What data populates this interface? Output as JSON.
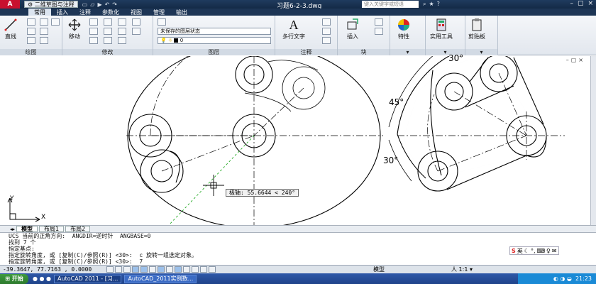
{
  "titlebar": {
    "app_logo": "A",
    "workspace": "二维草图与注释",
    "title": "习题6-2-3.dwg",
    "search_placeholder": "键入关键字或短语",
    "qat": [
      "▭",
      "▱",
      "▶",
      "↶",
      "↷"
    ],
    "title_icons": [
      "⌕",
      "★",
      "?"
    ],
    "window_buttons": [
      "–",
      "▢",
      "×"
    ]
  },
  "ribbon_tabs": [
    "常用",
    "插入",
    "注释",
    "参数化",
    "视图",
    "管理",
    "输出"
  ],
  "ribbon": {
    "panels": {
      "draw": "绘图",
      "modify": "修改",
      "layer": "图层",
      "annotation": "注释",
      "block": "块"
    },
    "draw_line": "直线",
    "modify_move": "移动",
    "layer_state": "未保存的图层状态",
    "layer_name": "0",
    "mtext": "多行文字",
    "insert": "插入",
    "properties": "特性",
    "utilities": "实用工具",
    "clipboard": "剪贴板"
  },
  "drawing": {
    "dim_top": "30°",
    "dim_left": "45°",
    "dim_bottom": "30°",
    "polar_tip": "极轴: 55.6644 < 240°",
    "ucs_x": "X",
    "ucs_y": "Y"
  },
  "layout_tabs": [
    "模型",
    "布局1",
    "布局2"
  ],
  "command_lines": [
    "UCS 当前的正角方向:  ANGDIR=逆时针  ANGBASE=0",
    "找到 7 个",
    "指定基点:",
    "指定旋转角度, 或 [复制(C)/参照(R)] <30>:  c 旋转一组选定对象。",
    "指定旋转角度, 或 [复制(C)/参照(R)] <30>:  7"
  ],
  "ime": [
    "S",
    "英",
    "☾",
    "°,",
    "⌨",
    "♀",
    "✉"
  ],
  "statusbar": {
    "coords": "-39.3647,  77.7163 , 0.0000",
    "model": "模型",
    "scale": "人 1:1 ▾"
  },
  "taskbar": {
    "start": "开始",
    "tasks": [
      "AutoCAD 2011 - [习...",
      "AutoCAD_2011实例数..."
    ],
    "time": "21:23"
  }
}
